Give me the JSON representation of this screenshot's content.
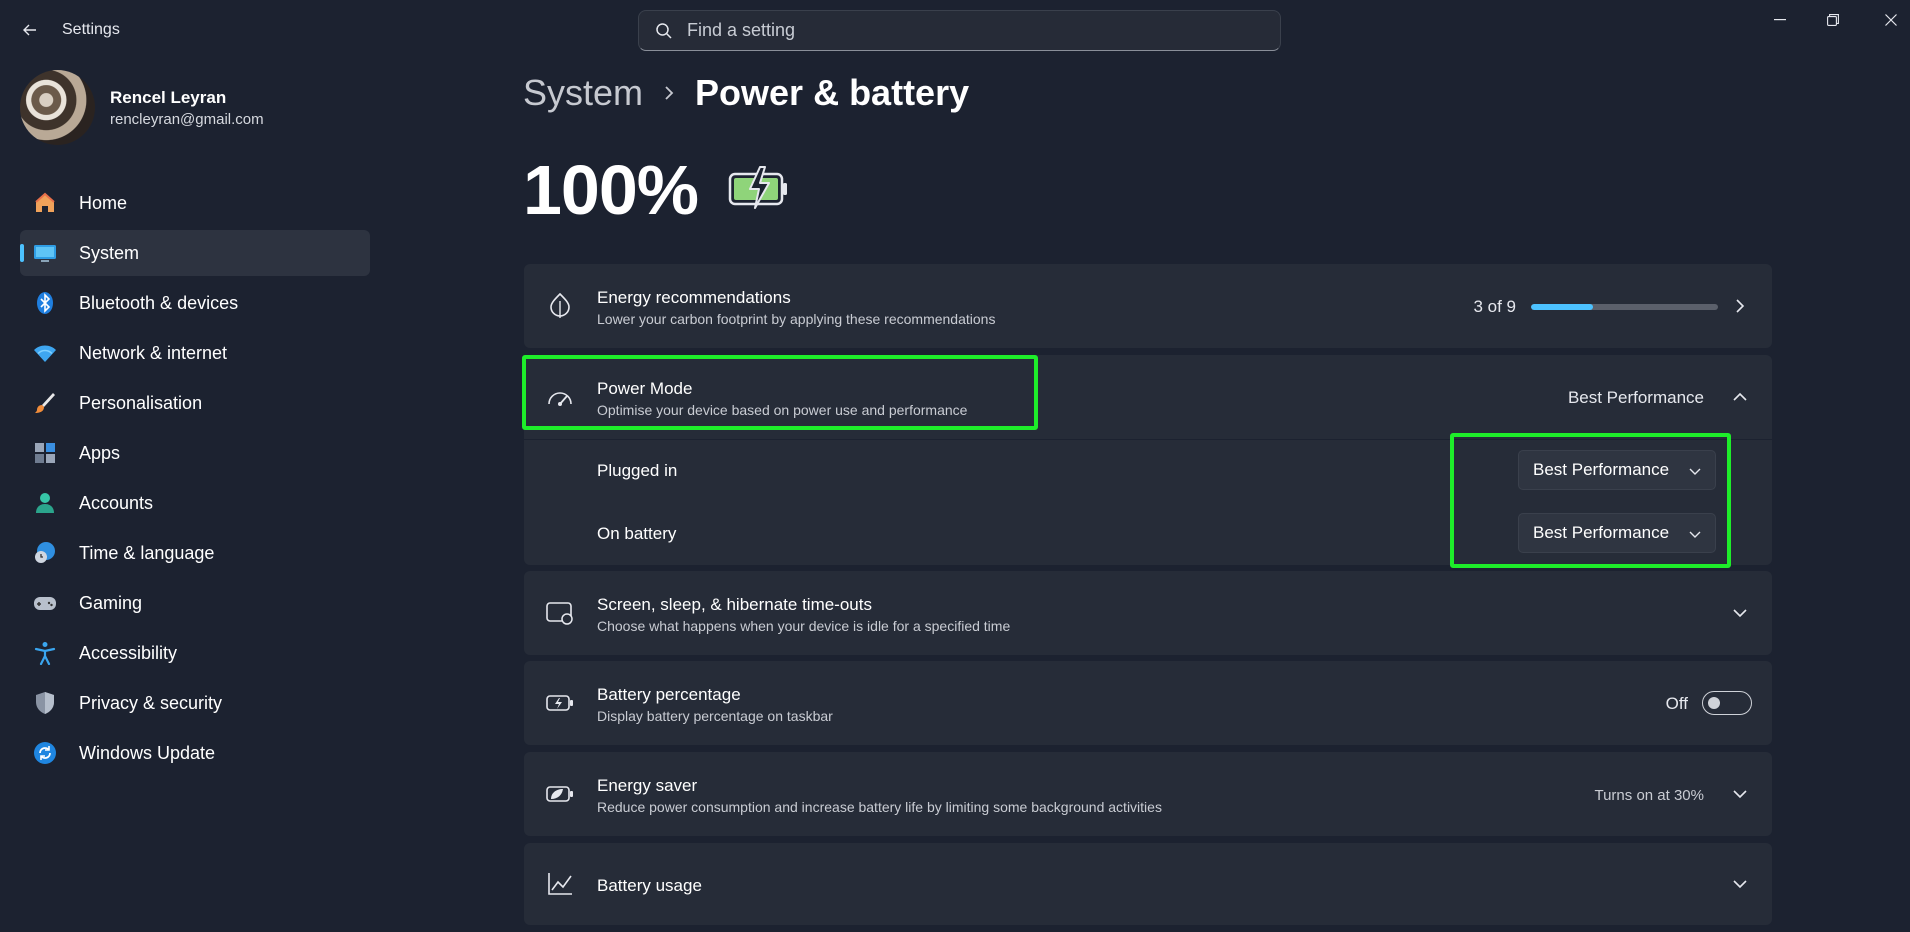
{
  "window": {
    "title": "Settings",
    "search_placeholder": "Find a setting"
  },
  "profile": {
    "name": "Rencel Leyran",
    "email": "rencleyran@gmail.com"
  },
  "sidebar": {
    "items": [
      {
        "label": "Home",
        "icon": "home-icon"
      },
      {
        "label": "System",
        "icon": "system-icon",
        "active": true
      },
      {
        "label": "Bluetooth & devices",
        "icon": "bluetooth-icon"
      },
      {
        "label": "Network & internet",
        "icon": "wifi-icon"
      },
      {
        "label": "Personalisation",
        "icon": "brush-icon"
      },
      {
        "label": "Apps",
        "icon": "apps-icon"
      },
      {
        "label": "Accounts",
        "icon": "accounts-icon"
      },
      {
        "label": "Time & language",
        "icon": "globe-clock-icon"
      },
      {
        "label": "Gaming",
        "icon": "gamepad-icon"
      },
      {
        "label": "Accessibility",
        "icon": "accessibility-icon"
      },
      {
        "label": "Privacy & security",
        "icon": "shield-icon"
      },
      {
        "label": "Windows Update",
        "icon": "update-icon"
      }
    ]
  },
  "breadcrumb": {
    "parent": "System",
    "current": "Power & battery"
  },
  "battery": {
    "percent_text": "100%"
  },
  "energy_recommendations": {
    "title": "Energy recommendations",
    "subtitle": "Lower your carbon footprint by applying these recommendations",
    "progress_text": "3 of 9",
    "progress_fraction": 0.333
  },
  "power_mode": {
    "title": "Power Mode",
    "subtitle": "Optimise your device based on power use and performance",
    "value": "Best Performance",
    "plugged_in_label": "Plugged in",
    "plugged_in_value": "Best Performance",
    "on_battery_label": "On battery",
    "on_battery_value": "Best Performance"
  },
  "screen_sleep": {
    "title": "Screen, sleep, & hibernate time-outs",
    "subtitle": "Choose what happens when your device is idle for a specified time"
  },
  "battery_percentage": {
    "title": "Battery percentage",
    "subtitle": "Display battery percentage on taskbar",
    "state": "Off"
  },
  "energy_saver": {
    "title": "Energy saver",
    "subtitle": "Reduce power consumption and increase battery life by limiting some background activities",
    "status": "Turns on at 30%"
  },
  "battery_usage": {
    "title": "Battery usage"
  },
  "colors": {
    "accent": "#4cc2ff",
    "highlight": "#1eed2a",
    "background": "#1c2230",
    "card": "#262c38"
  }
}
